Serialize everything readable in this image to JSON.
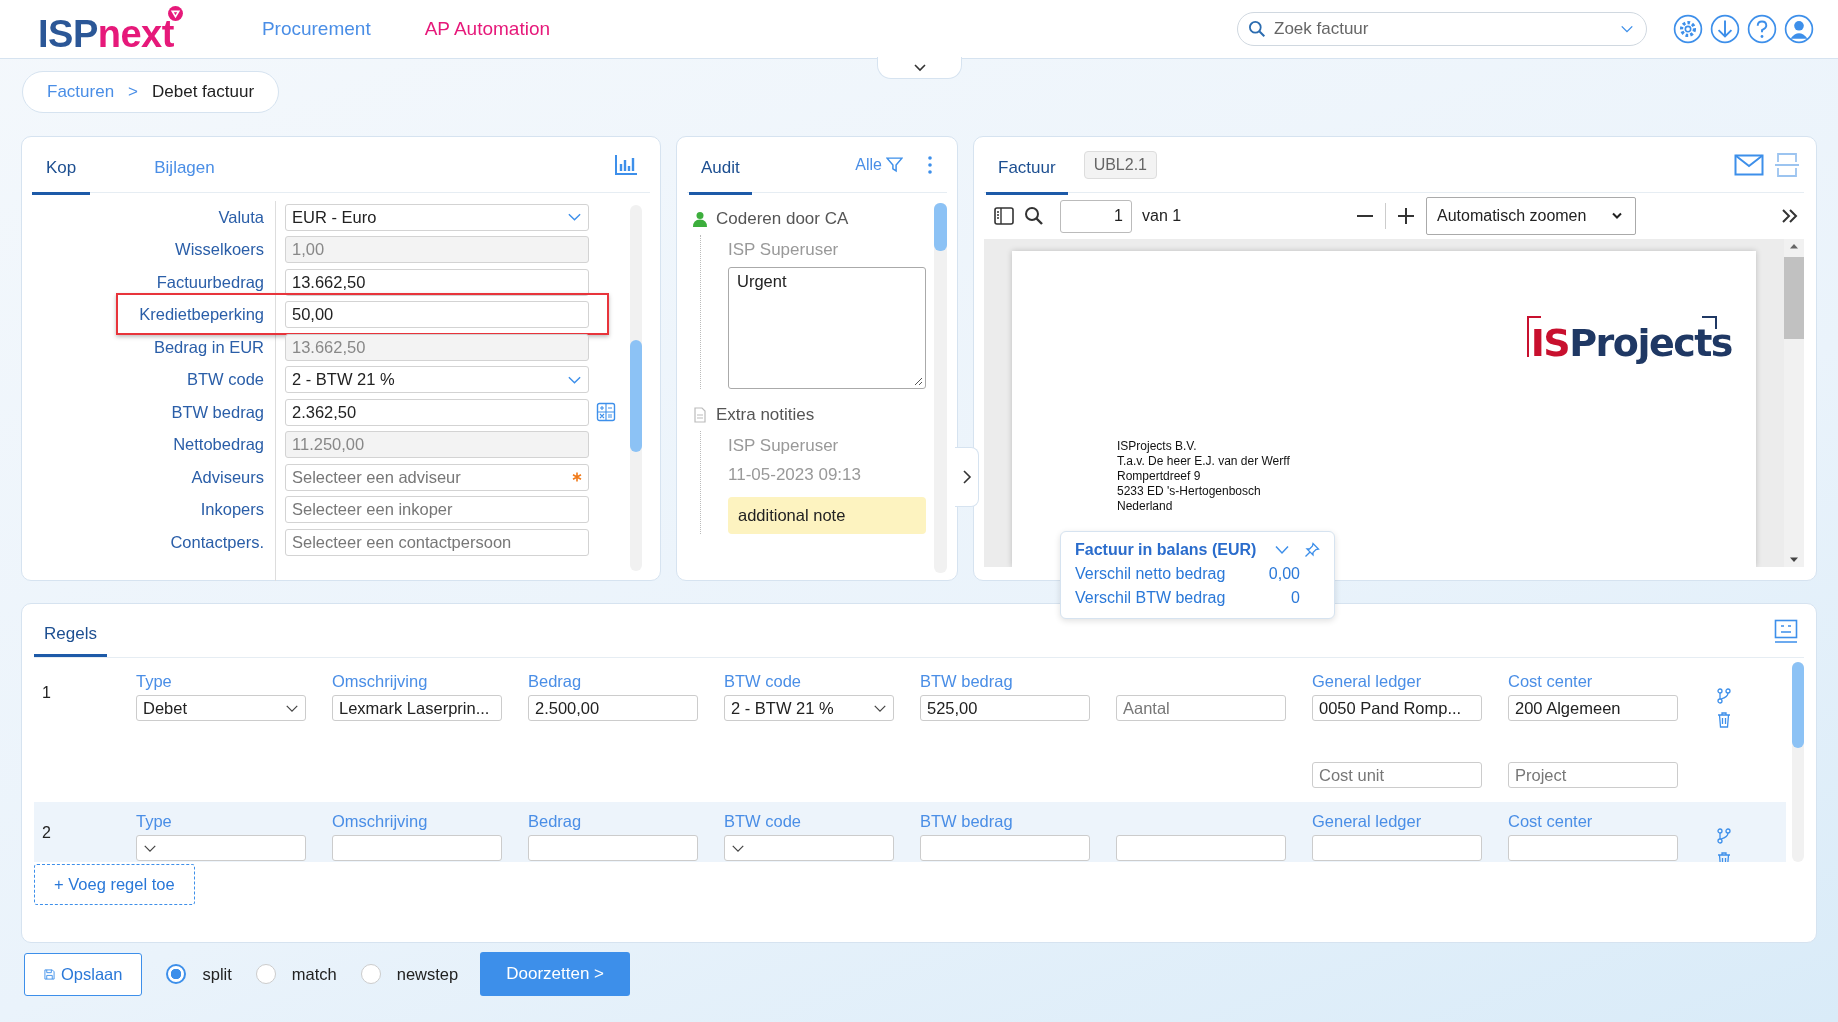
{
  "header": {
    "logo_main": "ISP",
    "logo_accent": "next",
    "nav": [
      {
        "label": "Procurement",
        "selected": false
      },
      {
        "label": "AP Automation",
        "selected": true
      }
    ],
    "search": {
      "placeholder": "Zoek factuur"
    }
  },
  "breadcrumb": {
    "items": [
      "Facturen",
      "Debet factuur"
    ],
    "separator": ">"
  },
  "kop": {
    "tabs": [
      {
        "label": "Kop",
        "selected": true
      },
      {
        "label": "Bijlagen",
        "selected": false
      }
    ],
    "fields": [
      {
        "label": "Valuta",
        "kind": "select",
        "value": "EUR - Euro",
        "disabled": false,
        "highlighted": false
      },
      {
        "label": "Wisselkoers",
        "kind": "text",
        "value": "1,00",
        "disabled": true,
        "highlighted": false
      },
      {
        "label": "Factuurbedrag",
        "kind": "text",
        "value": "13.662,50",
        "disabled": false,
        "highlighted": false
      },
      {
        "label": "Kredietbeperking",
        "kind": "text",
        "value": "50,00",
        "disabled": false,
        "highlighted": true
      },
      {
        "label": "Bedrag in EUR",
        "kind": "text",
        "value": "13.662,50",
        "disabled": true,
        "highlighted": false
      },
      {
        "label": "BTW code",
        "kind": "select",
        "value": "2 - BTW 21 %",
        "disabled": false,
        "highlighted": false
      },
      {
        "label": "BTW bedrag",
        "kind": "calc",
        "value": "2.362,50",
        "disabled": false,
        "highlighted": false
      },
      {
        "label": "Nettobedrag",
        "kind": "text",
        "value": "11.250,00",
        "disabled": true,
        "highlighted": false
      },
      {
        "label": "Adviseurs",
        "kind": "required",
        "placeholder": "Selecteer een adviseur",
        "disabled": false,
        "highlighted": false
      },
      {
        "label": "Inkopers",
        "kind": "text",
        "placeholder": "Selecteer een inkoper",
        "disabled": false,
        "highlighted": false
      },
      {
        "label": "Contactpers.",
        "kind": "text",
        "placeholder": "Selecteer een contactpersoon",
        "disabled": false,
        "highlighted": false
      }
    ]
  },
  "audit": {
    "tabs": [
      {
        "label": "Audit",
        "selected": true
      }
    ],
    "filter": "Alle",
    "entries": [
      {
        "kind": "task",
        "title": "Coderen door CA",
        "user": "ISP Superuser",
        "comment": "Urgent"
      },
      {
        "kind": "note",
        "title": "Extra notities",
        "user": "ISP Superuser",
        "date": "11-05-2023 09:13",
        "note": "additional note"
      }
    ]
  },
  "invoice": {
    "tabs": [
      {
        "label": "Factuur",
        "selected": true
      },
      {
        "label": "UBL2.1",
        "selected": false
      }
    ],
    "page": "1",
    "page_total": "van 1",
    "zoom": "Automatisch zoomen",
    "document": {
      "logo_accent": "IS",
      "logo_main": "Projects",
      "address": [
        "ISProjects B.V.",
        "T.a.v. De heer E.J. van der Werff",
        "Rompertdreef 9",
        "5233 ED  's-Hertogenbosch",
        "Nederland"
      ]
    }
  },
  "balance": {
    "title": "Factuur in balans (EUR)",
    "rows": [
      {
        "label": "Verschil netto bedrag",
        "value": "0,00"
      },
      {
        "label": "Verschil BTW bedrag",
        "value": "0"
      }
    ]
  },
  "lines": {
    "tabs": [
      {
        "label": "Regels",
        "selected": true
      }
    ],
    "rows": [
      {
        "number": "1",
        "selected": false,
        "fields": [
          {
            "label": "Type",
            "kind": "select",
            "value": "Debet"
          },
          {
            "label": "Omschrijving",
            "kind": "text",
            "value": "Lexmark Laserprin..."
          },
          {
            "label": "Bedrag",
            "kind": "text",
            "value": "2.500,00"
          },
          {
            "label": "BTW code",
            "kind": "select",
            "value": "2 - BTW 21 %"
          },
          {
            "label": "BTW bedrag",
            "kind": "text",
            "value": "525,00"
          },
          {
            "kind": "text",
            "placeholder": "Aantal"
          },
          {
            "label": "General ledger",
            "kind": "text",
            "value": "0050 Pand Romp..."
          },
          {
            "label": "Cost center",
            "kind": "text",
            "value": "200 Algemeen"
          }
        ],
        "extra": [
          {
            "placeholder": "Cost unit"
          },
          {
            "placeholder": "Project"
          }
        ]
      },
      {
        "number": "2",
        "selected": true,
        "fields": [
          {
            "label": "Type",
            "kind": "select"
          },
          {
            "label": "Omschrijving",
            "kind": "text"
          },
          {
            "label": "Bedrag",
            "kind": "text"
          },
          {
            "label": "BTW code",
            "kind": "select"
          },
          {
            "label": "BTW bedrag",
            "kind": "text"
          },
          {
            "kind": "text"
          },
          {
            "label": "General ledger",
            "kind": "text"
          },
          {
            "label": "Cost center",
            "kind": "text"
          }
        ]
      }
    ],
    "add_button": "+ Voeg regel toe"
  },
  "footer": {
    "save": "Opslaan",
    "options": [
      {
        "label": "split",
        "selected": true
      },
      {
        "label": "match",
        "selected": false
      },
      {
        "label": "newstep",
        "selected": false
      }
    ],
    "submit": "Doorzetten >"
  }
}
